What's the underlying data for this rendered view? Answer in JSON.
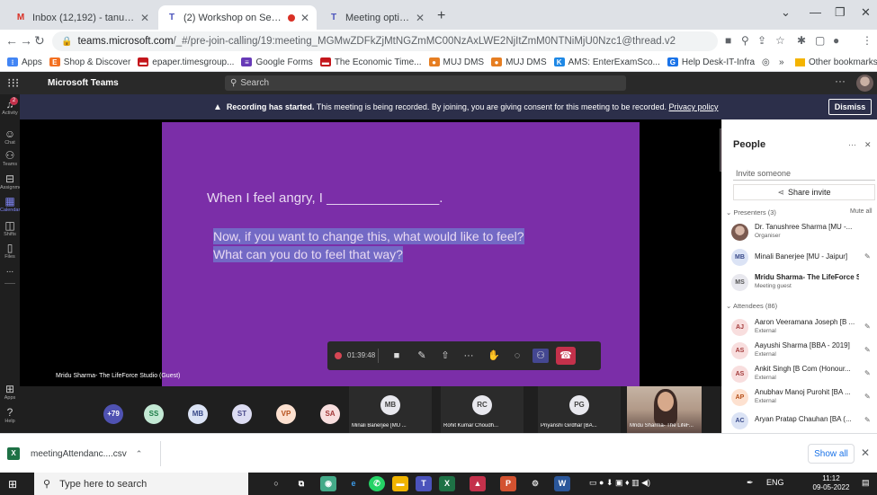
{
  "browser": {
    "tabs": [
      {
        "icon": "gmail-icon",
        "title": "Inbox (12,192) - tanu24feb@gm..."
      },
      {
        "icon": "teams-icon",
        "title": "(2) Workshop on Self awaren..."
      },
      {
        "icon": "teams-icon",
        "title": "Meeting options"
      }
    ],
    "new_tab": "+",
    "url_host": "teams.microsoft.com",
    "url_path": "/_#/pre-join-calling/19:meeting_MGMwZDFkZjMtNGZmMC00NzAxLWE2NjItZmM0NTNiMjU0Nzc1@thread.v2",
    "bookmarks": [
      {
        "label": "Apps",
        "color": "#4285f4"
      },
      {
        "label": "Shop & Discover",
        "color": "#f37021"
      },
      {
        "label": "epaper.timesgroup...",
        "color": "#c4161c"
      },
      {
        "label": "Google Forms",
        "color": "#673ab7"
      },
      {
        "label": "The Economic Time...",
        "color": "#c4161c"
      },
      {
        "label": "MUJ DMS",
        "color": "#e67e22"
      },
      {
        "label": "MUJ DMS",
        "color": "#e67e22"
      },
      {
        "label": "AMS: EnterExamSco...",
        "color": "#1e88e5"
      },
      {
        "label": "Help Desk-IT-Infra",
        "color": "#1a73e8"
      }
    ],
    "bookmarks_more": "»",
    "other_bookmarks": "Other bookmarks"
  },
  "teams": {
    "app_name": "Microsoft Teams",
    "search_placeholder": "Search",
    "app_bar": [
      {
        "label": "Activity",
        "icon": "bell-icon",
        "badge": "2"
      },
      {
        "label": "Chat",
        "icon": "chat-icon"
      },
      {
        "label": "Teams",
        "icon": "teams-group-icon"
      },
      {
        "label": "Assignments",
        "icon": "assignments-icon"
      },
      {
        "label": "Calendar",
        "icon": "calendar-icon"
      },
      {
        "label": "Shifts",
        "icon": "shifts-icon"
      },
      {
        "label": "Files",
        "icon": "files-icon"
      },
      {
        "label": "...",
        "icon": "more-icon"
      },
      {
        "label": "Apps",
        "icon": "apps-icon"
      },
      {
        "label": "Help",
        "icon": "help-icon"
      }
    ],
    "banner": {
      "bold": "Recording has started.",
      "text": "This meeting is being recorded. By joining, you are giving consent for this meeting to be recorded.",
      "link": "Privacy policy",
      "dismiss": "Dismiss"
    },
    "slide": {
      "line1": "When I feel angry, I _______________.",
      "line2": "Now, if you want to change this, what would like to feel?",
      "line3": "What can you do to feel that way?"
    },
    "stage_name": "Mridu Sharma- The LifeForce Studio (Guest)",
    "controls": {
      "timer": "01:39:48"
    },
    "strip": {
      "more": "+79",
      "circles": [
        {
          "initials": "SS",
          "bg": "#c3e9d4",
          "fg": "#1b7b45"
        },
        {
          "initials": "MB",
          "bg": "#dbe3f5",
          "fg": "#3a4b8a"
        },
        {
          "initials": "ST",
          "bg": "#dcdcf2",
          "fg": "#4a4a8a"
        },
        {
          "initials": "VP",
          "bg": "#fde1d0",
          "fg": "#b5501a"
        },
        {
          "initials": "SA",
          "bg": "#f8dede",
          "fg": "#a33a3a"
        }
      ],
      "tiles": [
        {
          "initials": "MB",
          "name": "Minali Banerjee [MU ..."
        },
        {
          "initials": "RC",
          "name": "Rohit Kumar Choudh..."
        },
        {
          "initials": "PG",
          "name": "Priyanshi Girdhar [BA..."
        }
      ],
      "video_name": "Mridu Sharma- The LifeF..."
    },
    "people": {
      "title": "People",
      "invite_placeholder": "Invite someone",
      "share_invite": "Share invite",
      "presenters_label": "Presenters (3)",
      "mute_all": "Mute all",
      "presenters": [
        {
          "initials": "",
          "name": "Dr. Tanushree Sharma [MU -...",
          "role": "Organiser",
          "bg": "#8a6a5a",
          "fg": "#fff",
          "bold": false
        },
        {
          "initials": "MB",
          "name": "Minali Banerjee [MU - Jaipur]",
          "role": "",
          "bg": "#dbe3f5",
          "fg": "#3a4b8a",
          "bold": false
        },
        {
          "initials": "MS",
          "name": "Mridu Sharma- The LifeForce St...",
          "role": "Meeting guest",
          "bg": "#e8e8ee",
          "fg": "#555",
          "bold": true
        }
      ],
      "attendees_label": "Attendees (86)",
      "attendees": [
        {
          "initials": "AJ",
          "name": "Aaron Veeramana Joseph [B ...",
          "role": "External",
          "bg": "#f8dede",
          "fg": "#a33a3a"
        },
        {
          "initials": "AS",
          "name": "Aayushi Sharma [BBA - 2019]",
          "role": "External",
          "bg": "#f8dede",
          "fg": "#a33a3a"
        },
        {
          "initials": "AS",
          "name": "Ankit Singh [B Com (Honour...",
          "role": "External",
          "bg": "#f8dede",
          "fg": "#a33a3a"
        },
        {
          "initials": "AP",
          "name": "Anubhav Manoj Purohit [BA ...",
          "role": "External",
          "bg": "#fde1d0",
          "fg": "#b5501a"
        },
        {
          "initials": "AC",
          "name": "Aryan Pratap Chauhan [BA (...",
          "role": "",
          "bg": "#dbe3f5",
          "fg": "#3a4b8a"
        }
      ]
    }
  },
  "downloads": {
    "file": "meetingAttendanc....csv",
    "show_all": "Show all"
  },
  "taskbar": {
    "search_placeholder": "Type here to search",
    "lang": "ENG",
    "time": "11:12",
    "date": "09-05-2022"
  }
}
